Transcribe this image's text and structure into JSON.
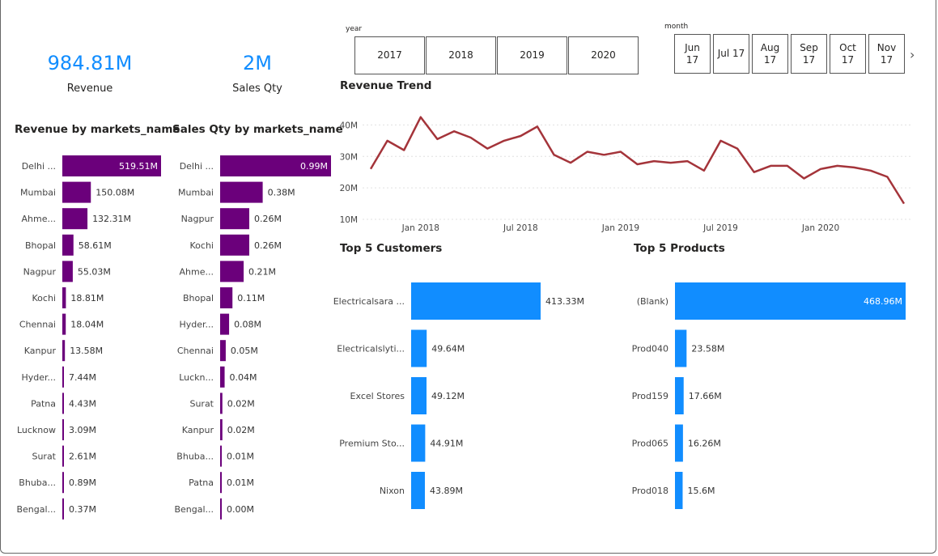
{
  "kpis": {
    "revenue": {
      "value": "984.81M",
      "label": "Revenue"
    },
    "sales_qty": {
      "value": "2M",
      "label": "Sales Qty"
    }
  },
  "slicers": {
    "year": {
      "label": "year",
      "options": [
        "2017",
        "2018",
        "2019",
        "2020"
      ]
    },
    "month": {
      "label": "month",
      "options": [
        [
          "Jun",
          "17"
        ],
        [
          "Jul 17"
        ],
        [
          "Aug",
          "17"
        ],
        [
          "Sep",
          "17"
        ],
        [
          "Oct",
          "17"
        ],
        [
          "Nov",
          "17"
        ]
      ]
    }
  },
  "colors": {
    "purple": "#6B007B",
    "blue": "#118DFF",
    "line": "#A4343A",
    "grid": "#E0E0E0"
  },
  "chart_data": [
    {
      "type": "bar",
      "orientation": "horizontal",
      "title": "Revenue by markets_name",
      "categories": [
        "Delhi ...",
        "Mumbai",
        "Ahme...",
        "Bhopal",
        "Nagpur",
        "Kochi",
        "Chennai",
        "Kanpur",
        "Hyder...",
        "Patna",
        "Lucknow",
        "Surat",
        "Bhuba...",
        "Bengal..."
      ],
      "values": [
        519.51,
        150.08,
        132.31,
        58.61,
        55.03,
        18.81,
        18.04,
        13.58,
        7.44,
        4.43,
        3.09,
        2.61,
        0.89,
        0.37
      ],
      "labels": [
        "519.51M",
        "150.08M",
        "132.31M",
        "58.61M",
        "55.03M",
        "18.81M",
        "18.04M",
        "13.58M",
        "7.44M",
        "4.43M",
        "3.09M",
        "2.61M",
        "0.89M",
        "0.37M"
      ],
      "color": "#6B007B"
    },
    {
      "type": "bar",
      "orientation": "horizontal",
      "title": "Sales Qty by markets_name",
      "categories": [
        "Delhi ...",
        "Mumbai",
        "Nagpur",
        "Kochi",
        "Ahme...",
        "Bhopal",
        "Hyder...",
        "Chennai",
        "Luckn...",
        "Surat",
        "Kanpur",
        "Bhuba...",
        "Patna",
        "Bengal..."
      ],
      "values": [
        0.99,
        0.38,
        0.26,
        0.26,
        0.21,
        0.11,
        0.08,
        0.05,
        0.04,
        0.02,
        0.02,
        0.01,
        0.01,
        0.0
      ],
      "labels": [
        "0.99M",
        "0.38M",
        "0.26M",
        "0.26M",
        "0.21M",
        "0.11M",
        "0.08M",
        "0.05M",
        "0.04M",
        "0.02M",
        "0.02M",
        "0.01M",
        "0.01M",
        "0.00M"
      ],
      "color": "#6B007B"
    },
    {
      "type": "line",
      "title": "Revenue Trend",
      "x": [
        "2017-10",
        "2017-11",
        "2017-12",
        "2018-01",
        "2018-02",
        "2018-03",
        "2018-04",
        "2018-05",
        "2018-06",
        "2018-07",
        "2018-08",
        "2018-09",
        "2018-10",
        "2018-11",
        "2018-12",
        "2019-01",
        "2019-02",
        "2019-03",
        "2019-04",
        "2019-05",
        "2019-06",
        "2019-07",
        "2019-08",
        "2019-09",
        "2019-10",
        "2019-11",
        "2019-12",
        "2020-01",
        "2020-02",
        "2020-03",
        "2020-04",
        "2020-05",
        "2020-06"
      ],
      "y": [
        26.0,
        35.0,
        32.0,
        42.5,
        35.5,
        38.0,
        36.0,
        32.5,
        35.0,
        36.5,
        39.5,
        30.5,
        28.0,
        31.5,
        30.5,
        31.5,
        27.5,
        28.5,
        28.0,
        28.5,
        25.5,
        35.0,
        32.5,
        25.0,
        27.0,
        27.0,
        23.0,
        26.0,
        27.0,
        26.5,
        25.5,
        23.5,
        15.0
      ],
      "ytick_labels": [
        "10M",
        "20M",
        "30M",
        "40M"
      ],
      "yticks": [
        10,
        20,
        30,
        40
      ],
      "ylim": [
        10,
        45
      ],
      "xtick_labels": [
        "Jan 2018",
        "Jul 2018",
        "Jan 2019",
        "Jul 2019",
        "Jan 2020"
      ],
      "xticks": [
        "2018-01",
        "2018-07",
        "2019-01",
        "2019-07",
        "2020-01"
      ],
      "grid": true,
      "color": "#A4343A"
    },
    {
      "type": "bar",
      "orientation": "horizontal",
      "title": "Top 5 Customers",
      "categories": [
        "Electricalsara ...",
        "Electricalslyti...",
        "Excel Stores",
        "Premium Sto...",
        "Nixon"
      ],
      "values": [
        413.33,
        49.64,
        49.12,
        44.91,
        43.89
      ],
      "labels": [
        "413.33M",
        "49.64M",
        "49.12M",
        "44.91M",
        "43.89M"
      ],
      "color": "#118DFF"
    },
    {
      "type": "bar",
      "orientation": "horizontal",
      "title": "Top 5 Products",
      "categories": [
        "(Blank)",
        "Prod040",
        "Prod159",
        "Prod065",
        "Prod018"
      ],
      "values": [
        468.96,
        23.58,
        17.66,
        16.26,
        15.6
      ],
      "labels": [
        "468.96M",
        "23.58M",
        "17.66M",
        "16.26M",
        "15.6M"
      ],
      "color": "#118DFF"
    }
  ]
}
